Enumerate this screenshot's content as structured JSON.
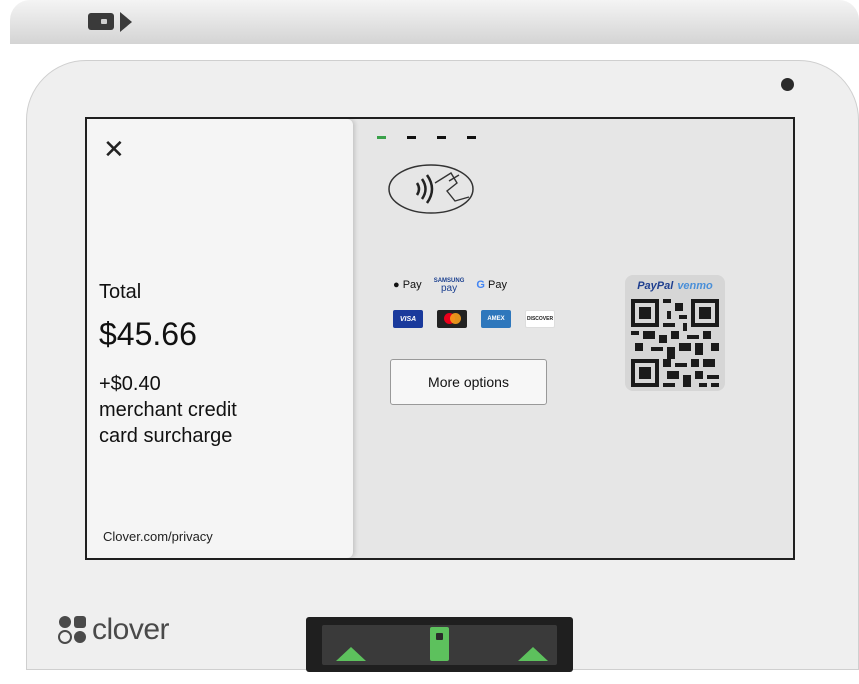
{
  "left_panel": {
    "close_glyph": "✕",
    "total_label": "Total",
    "total_amount": "$45.66",
    "surcharge_lines": [
      "+$0.40",
      "merchant credit",
      "card surcharge"
    ],
    "privacy": "Clover.com/privacy"
  },
  "payment": {
    "progress_steps": 4,
    "progress_active": 1,
    "wallets": {
      "apple_pay": "Pay",
      "samsung_top": "SAMSUNG",
      "samsung_bottom": "pay",
      "google_g": "G",
      "google_pay": "Pay"
    },
    "cards": {
      "visa": "VISA",
      "amex": "AMEX",
      "discover": "DISCOVER"
    },
    "more_options": "More options",
    "qr_brand_paypal": "PayPal",
    "qr_brand_venmo": "venmo"
  },
  "device": {
    "brand": "clover"
  },
  "colors": {
    "accent_green": "#3aa14a",
    "reader_green": "#5dc15d",
    "paypal_blue": "#1f3f8f",
    "venmo_blue": "#4a8fd8"
  }
}
